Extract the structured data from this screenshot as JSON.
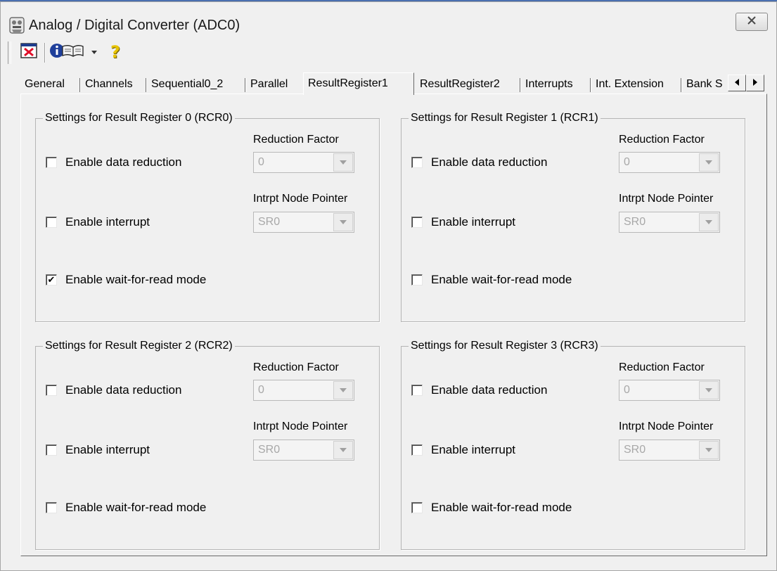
{
  "window": {
    "title": "Analog / Digital Converter  (ADC0)",
    "close_icon": "close-x-icon"
  },
  "toolbar": {
    "items": [
      {
        "name": "close-document-icon"
      },
      {
        "name": "info-book-icon"
      },
      {
        "name": "dropdown-arrow-icon"
      },
      {
        "name": "help-question-icon",
        "text": "?"
      }
    ]
  },
  "tabs": [
    {
      "label": "General",
      "active": false
    },
    {
      "label": "Channels",
      "active": false
    },
    {
      "label": "Sequential0_2",
      "active": false
    },
    {
      "label": "Parallel",
      "active": false
    },
    {
      "label": "ResultRegister1",
      "active": true
    },
    {
      "label": "ResultRegister2",
      "active": false
    },
    {
      "label": "Interrupts",
      "active": false
    },
    {
      "label": "Int. Extension",
      "active": false
    },
    {
      "label": "Bank S",
      "active": false
    }
  ],
  "groups": [
    {
      "title": "Settings for Result Register 0 (RCR0)",
      "reduction_factor_label": "Reduction Factor",
      "enable_data_reduction_label": "Enable data reduction",
      "enable_data_reduction_checked": false,
      "reduction_factor_value": "0",
      "intrpt_node_pointer_label": "Intrpt Node Pointer",
      "enable_interrupt_label": "Enable interrupt",
      "enable_interrupt_checked": false,
      "intrpt_node_pointer_value": "SR0",
      "enable_wait_label": "Enable wait-for-read mode",
      "enable_wait_checked": true
    },
    {
      "title": "Settings for Result Register 1 (RCR1)",
      "reduction_factor_label": "Reduction Factor",
      "enable_data_reduction_label": "Enable data reduction",
      "enable_data_reduction_checked": false,
      "reduction_factor_value": "0",
      "intrpt_node_pointer_label": "Intrpt Node Pointer",
      "enable_interrupt_label": "Enable interrupt",
      "enable_interrupt_checked": false,
      "intrpt_node_pointer_value": "SR0",
      "enable_wait_label": "Enable wait-for-read mode",
      "enable_wait_checked": false
    },
    {
      "title": "Settings for Result Register 2 (RCR2)",
      "reduction_factor_label": "Reduction Factor",
      "enable_data_reduction_label": "Enable data reduction",
      "enable_data_reduction_checked": false,
      "reduction_factor_value": "0",
      "intrpt_node_pointer_label": "Intrpt Node Pointer",
      "enable_interrupt_label": "Enable interrupt",
      "enable_interrupt_checked": false,
      "intrpt_node_pointer_value": "SR0",
      "enable_wait_label": "Enable wait-for-read mode",
      "enable_wait_checked": false
    },
    {
      "title": "Settings for Result Register 3 (RCR3)",
      "reduction_factor_label": "Reduction Factor",
      "enable_data_reduction_label": "Enable data reduction",
      "enable_data_reduction_checked": false,
      "reduction_factor_value": "0",
      "intrpt_node_pointer_label": "Intrpt Node Pointer",
      "enable_interrupt_label": "Enable interrupt",
      "enable_interrupt_checked": false,
      "intrpt_node_pointer_value": "SR0",
      "enable_wait_label": "Enable wait-for-read mode",
      "enable_wait_checked": false
    }
  ],
  "check_glyph": "✔",
  "colors": {
    "accent_line": "#4a6fb0",
    "panel_bg": "#f0f0f0",
    "disabled_text": "#a8a8a8"
  }
}
